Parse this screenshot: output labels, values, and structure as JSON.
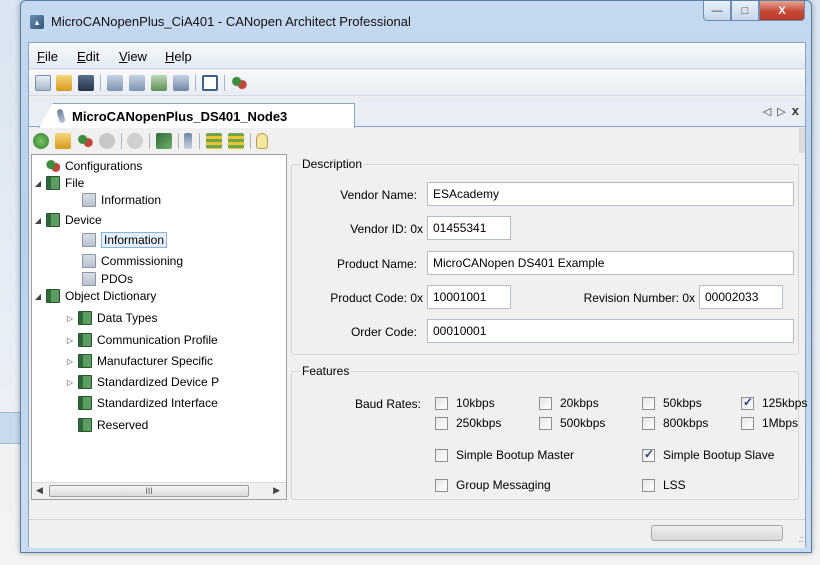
{
  "window": {
    "title": "MicroCANopenPlus_CiA401 - CANopen Architect Professional",
    "controls": {
      "minimize": "—",
      "maximize": "□",
      "close": "X"
    }
  },
  "menu": [
    "File",
    "Edit",
    "View",
    "Help"
  ],
  "document_tab": {
    "label": "MicroCANopenPlus_DS401_Node3",
    "nav_prev": "◁",
    "nav_next": "▷",
    "close": "x"
  },
  "tree": {
    "h_scroll_thumb": "III",
    "items": [
      {
        "label": "Configurations",
        "icon": "configurations-icon"
      },
      {
        "label": "File",
        "icon": "book-icon",
        "expanded": true
      },
      {
        "label": "Information",
        "icon": "page-icon"
      },
      {
        "label": "Device",
        "icon": "book-icon",
        "expanded": true
      },
      {
        "label": "Information",
        "icon": "page-icon",
        "selected": true
      },
      {
        "label": "Commissioning",
        "icon": "page-icon"
      },
      {
        "label": "PDOs",
        "icon": "page-icon"
      },
      {
        "label": "Object Dictionary",
        "icon": "book-icon",
        "expanded": true
      },
      {
        "label": "Data Types",
        "icon": "book-icon",
        "collapsed": true
      },
      {
        "label": "Communication Profile",
        "icon": "book-icon",
        "collapsed": true
      },
      {
        "label": "Manufacturer Specific",
        "icon": "book-icon",
        "collapsed": true
      },
      {
        "label": "Standardized Device P",
        "icon": "book-icon",
        "collapsed": true
      },
      {
        "label": "Standardized Interface",
        "icon": "book-icon"
      },
      {
        "label": "Reserved",
        "icon": "book-icon"
      }
    ]
  },
  "description": {
    "legend": "Description",
    "vendor_name_label": "Vendor Name:",
    "vendor_name": "ESAcademy",
    "vendor_id_label": "Vendor ID: 0x",
    "vendor_id": "01455341",
    "product_name_label": "Product Name:",
    "product_name": "MicroCANopen DS401 Example",
    "product_code_label": "Product Code: 0x",
    "product_code": "10001001",
    "revision_label": "Revision Number: 0x",
    "revision": "00002033",
    "order_code_label": "Order Code:",
    "order_code": "00010001"
  },
  "features": {
    "legend": "Features",
    "baud_rates_label": "Baud Rates:",
    "baud": [
      {
        "label": "10kbps",
        "checked": false
      },
      {
        "label": "20kbps",
        "checked": false
      },
      {
        "label": "50kbps",
        "checked": false
      },
      {
        "label": "125kbps",
        "checked": true
      },
      {
        "label": "250kbps",
        "checked": false
      },
      {
        "label": "500kbps",
        "checked": false
      },
      {
        "label": "800kbps",
        "checked": false
      },
      {
        "label": "1Mbps",
        "checked": false
      }
    ],
    "simple_bootup_master": {
      "label": "Simple Bootup Master",
      "checked": false
    },
    "simple_bootup_slave": {
      "label": "Simple Bootup Slave",
      "checked": true
    },
    "group_messaging": {
      "label": "Group Messaging",
      "checked": false
    },
    "lss": {
      "label": "LSS",
      "checked": false
    }
  },
  "statusbar": {
    "grip": ".::"
  }
}
